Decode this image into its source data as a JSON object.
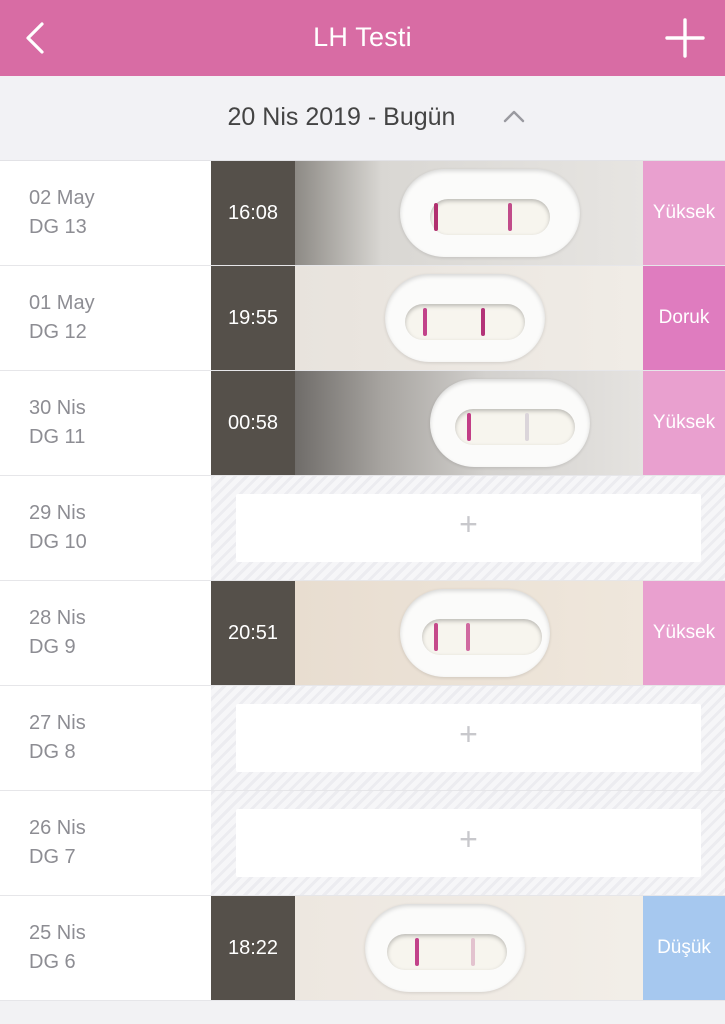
{
  "header": {
    "title": "LH Testi",
    "back_icon": "chevron-left-icon",
    "add_icon": "plus-icon",
    "color": "#d86ca4"
  },
  "range": {
    "label": "20 Nis 2019 - Bugün",
    "toggle_icon": "chevron-up-icon"
  },
  "colors": {
    "high": "#e9a0cf",
    "peak": "#df7cbf",
    "low": "#a6c8ef"
  },
  "entries": [
    {
      "date": "02 May",
      "cycle_day": "DG 13",
      "time": "16:08",
      "result": "Yüksek",
      "has_photo": true
    },
    {
      "date": "01 May",
      "cycle_day": "DG 12",
      "time": "19:55",
      "result": "Doruk",
      "has_photo": true
    },
    {
      "date": "30 Nis",
      "cycle_day": "DG 11",
      "time": "00:58",
      "result": "Yüksek",
      "has_photo": true
    },
    {
      "date": "29 Nis",
      "cycle_day": "DG 10",
      "add_label": "+",
      "has_photo": false
    },
    {
      "date": "28 Nis",
      "cycle_day": "DG 9",
      "time": "20:51",
      "result": "Yüksek",
      "has_photo": true
    },
    {
      "date": "27 Nis",
      "cycle_day": "DG 8",
      "add_label": "+",
      "has_photo": false
    },
    {
      "date": "26 Nis",
      "cycle_day": "DG 7",
      "add_label": "+",
      "has_photo": false
    },
    {
      "date": "25 Nis",
      "cycle_day": "DG 6",
      "time": "18:22",
      "result": "Düşük",
      "has_photo": true
    }
  ]
}
